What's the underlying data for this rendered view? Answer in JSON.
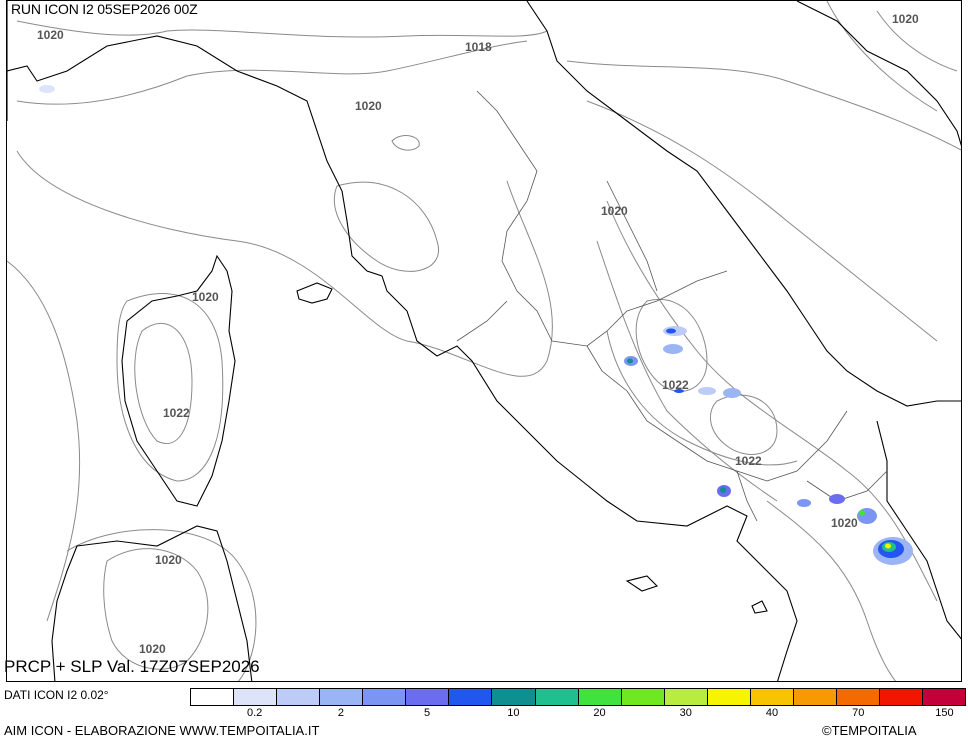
{
  "header": {
    "run": "RUN ICON I2 05SEP2026 00Z"
  },
  "footer": {
    "valid": "PRCP + SLP Val. 17Z07SEP2026",
    "dati": "DATI ICON I2 0.02°",
    "credit": "AIM ICON - ELABORAZIONE WWW.TEMPOITALIA.IT",
    "copyright": "©TEMPOITALIA"
  },
  "isobar_labels": {
    "l1": "1020",
    "l2": "1018",
    "l3": "1020",
    "l4": "1020",
    "l5": "1020",
    "l6": "1020",
    "l7": "1022",
    "l8": "1022",
    "l9": "1022",
    "l10": "1020",
    "l11": "1020",
    "l12": "1020"
  },
  "colorbar": {
    "colors": [
      "#ffffff",
      "#dde4fa",
      "#bcccf6",
      "#9ab4f4",
      "#7c95f2",
      "#6b6cf0",
      "#2356f0",
      "#0f8f8f",
      "#1fbf8f",
      "#3fe23f",
      "#70e81f",
      "#b8ec3f",
      "#f7f400",
      "#f6c400",
      "#f59a00",
      "#f56a00",
      "#f01600",
      "#c4003a"
    ],
    "ticks": [
      {
        "label": "0.2",
        "index": 1
      },
      {
        "label": "2",
        "index": 3
      },
      {
        "label": "5",
        "index": 5
      },
      {
        "label": "10",
        "index": 7
      },
      {
        "label": "20",
        "index": 9
      },
      {
        "label": "30",
        "index": 11
      },
      {
        "label": "40",
        "index": 13
      },
      {
        "label": "70",
        "index": 15
      },
      {
        "label": "150",
        "index": 17
      }
    ]
  }
}
